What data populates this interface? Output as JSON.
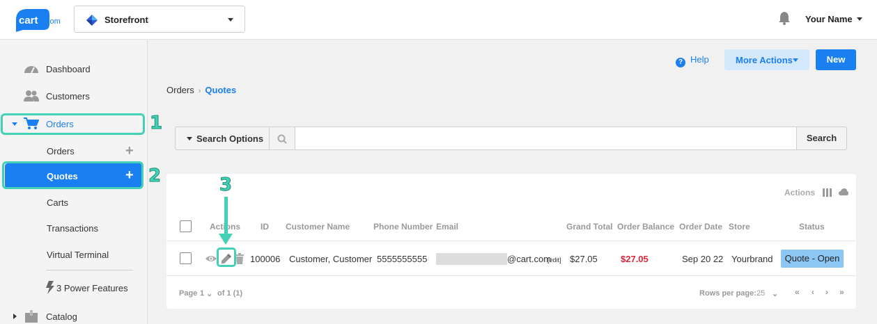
{
  "header": {
    "logo_text": "cart.com",
    "store_name": "Storefront",
    "user_name": "Your Name"
  },
  "sidebar": {
    "items": [
      {
        "label": "Dashboard",
        "icon": "dashboard-icon"
      },
      {
        "label": "Customers",
        "icon": "users-icon"
      },
      {
        "label": "Orders",
        "icon": "cart-icon",
        "expanded": true
      },
      {
        "label": "Catalog",
        "icon": "box-icon"
      }
    ],
    "orders_sub": {
      "orders": "Orders",
      "quotes": "Quotes",
      "carts": "Carts",
      "transactions": "Transactions",
      "virtual_terminal": "Virtual Terminal",
      "power_features": "3 Power Features"
    }
  },
  "callouts": [
    "1",
    "2",
    "3"
  ],
  "actions": {
    "help": "Help",
    "more_actions": "More Actions",
    "new": "New"
  },
  "breadcrumb": {
    "parent": "Orders",
    "current": "Quotes"
  },
  "search": {
    "options_label": "Search Options",
    "placeholder": "",
    "button": "Search"
  },
  "table": {
    "toolbar_label": "Actions",
    "columns": [
      "Actions",
      "ID",
      "Customer Name",
      "Phone Number",
      "Email",
      "Grand Total",
      "Order Balance",
      "Order Date",
      "Store",
      "Status"
    ],
    "rows": [
      {
        "id": "100006",
        "customer": "Customer, Customer",
        "phone": "5555555555",
        "email_domain": "@cart.com",
        "edit_link": "[edit]",
        "grand_total": "$27.05",
        "order_balance": "$27.05",
        "order_date": "Sep 20 22",
        "store": "Yourbrand",
        "status": "Quote - Open"
      }
    ]
  },
  "pagination": {
    "page_label": "Page",
    "page": "1",
    "of_label": "of 1 (1)",
    "rows_label": "Rows per page:",
    "rows_value": "25"
  },
  "colors": {
    "accent": "#1a7ff0",
    "callout": "#42d1b5",
    "balance": "#e0243a",
    "status_bg": "#8cc7f3"
  }
}
